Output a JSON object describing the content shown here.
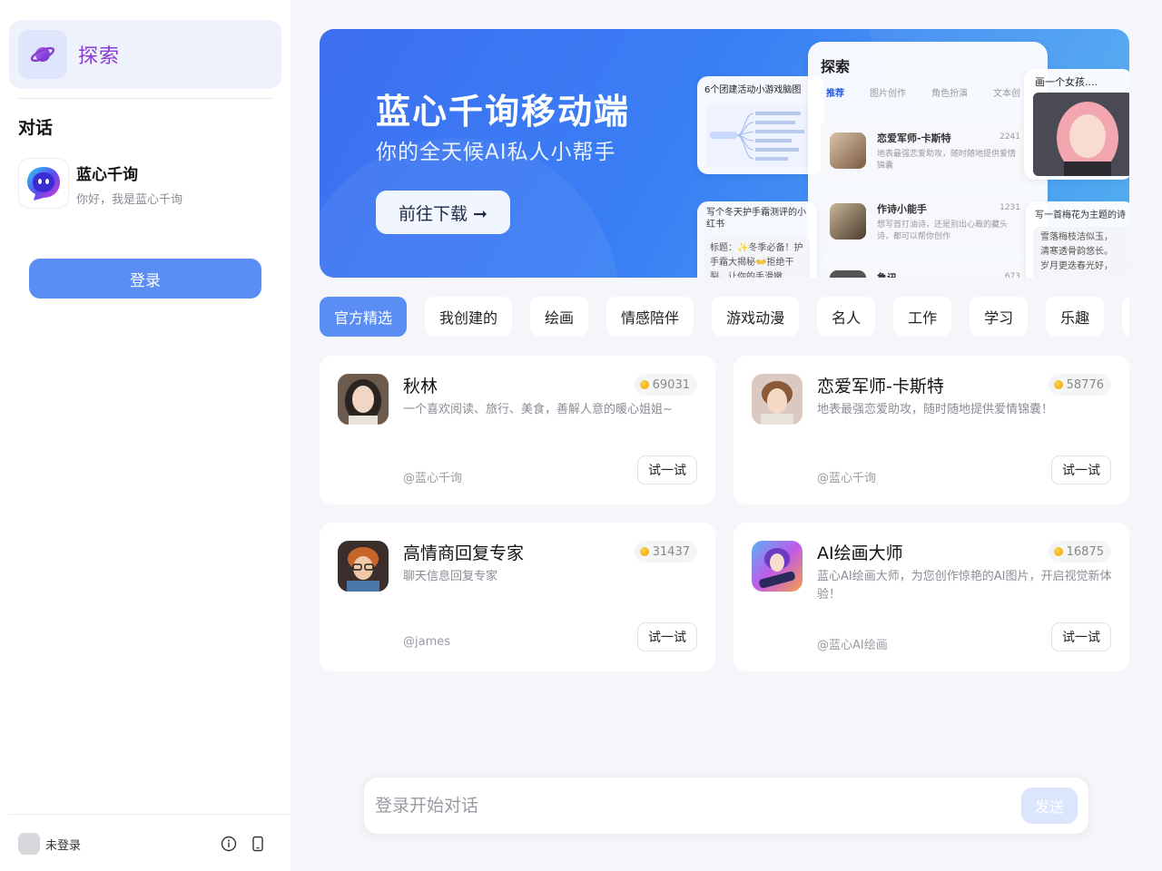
{
  "sidebar": {
    "explore_label": "探索",
    "section_title": "对话",
    "conversation": {
      "title": "蓝心千询",
      "subtitle": "你好，我是蓝心千询"
    },
    "login_label": "登录",
    "user_label": "未登录"
  },
  "banner": {
    "title": "蓝心千询移动端",
    "subtitle": "你的全天候AI私人小帮手",
    "button_label": "前往下载 ➞",
    "mock": {
      "mindmap_title": "6个团建活动小游戏脑图",
      "explore_title": "探索",
      "explore_tabs": [
        "推荐",
        "图片创作",
        "角色扮演",
        "文本创"
      ],
      "explore_items": [
        {
          "name": "恋爱军师-卡斯特",
          "count": "2241",
          "desc": "地表最强恋爱助攻，随时随地提供爱情锦囊"
        },
        {
          "name": "作诗小能手",
          "count": "1231",
          "desc": "想写首打油诗，还是别出心裁的藏头诗，都可以帮你创作"
        },
        {
          "name": "鲁讯",
          "count": "673",
          "desc": ""
        }
      ],
      "girl_title": "画一个女孩....",
      "note_title": "写个冬天护手霜测评的小红书",
      "note_body": "标题：✨冬季必备！护手霜大揭秘👐拒绝干裂，让你的手滑嫩",
      "poem_title": "写一首梅花为主题的诗",
      "poem_lines": [
        "雪落梅枝洁似玉，",
        "清寒透骨韵悠长。",
        "岁月更迭春光好，"
      ]
    }
  },
  "tabs": [
    "官方精选",
    "我创建的",
    "绘画",
    "情感陪伴",
    "游戏动漫",
    "名人",
    "工作",
    "学习",
    "乐趣"
  ],
  "active_tab": "官方精选",
  "cards": [
    {
      "name": "秋林",
      "count": "69031",
      "desc": "一个喜欢阅读、旅行、美食，善解人意的暖心姐姐~",
      "author": "@蓝心千询",
      "button": "试一试"
    },
    {
      "name": "恋爱军师-卡斯特",
      "count": "58776",
      "desc": "地表最强恋爱助攻，随时随地提供爱情锦囊！",
      "author": "@蓝心千询",
      "button": "试一试"
    },
    {
      "name": "高情商回复专家",
      "count": "31437",
      "desc": "聊天信息回复专家",
      "author": "@james",
      "button": "试一试"
    },
    {
      "name": "AI绘画大师",
      "count": "16875",
      "desc": "蓝心AI绘画大师，为您创作惊艳的AI图片，开启视觉新体验！",
      "author": "@蓝心AI绘画",
      "button": "试一试"
    }
  ],
  "input": {
    "placeholder": "登录开始对话",
    "send_label": "发送"
  },
  "colors": {
    "accent": "#5b8ef5",
    "explore_text": "#8a3ccf",
    "send_disabled": "#dbe6fd"
  }
}
